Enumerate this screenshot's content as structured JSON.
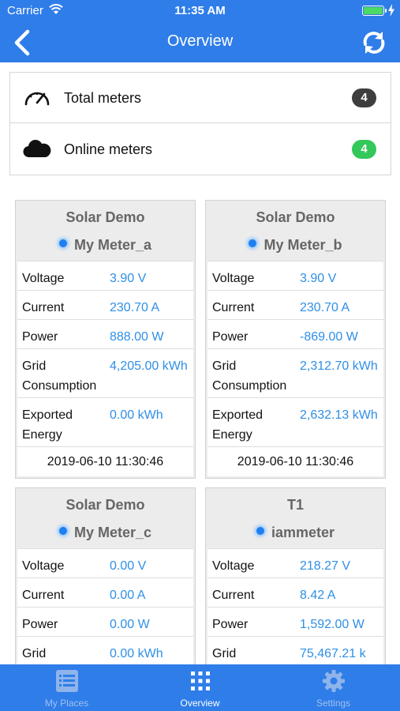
{
  "status_bar": {
    "carrier": "Carrier",
    "time": "11:35 AM"
  },
  "nav": {
    "title": "Overview",
    "back_icon": "chevron-left-icon",
    "refresh_icon": "refresh-icon"
  },
  "summary": {
    "total": {
      "label": "Total meters",
      "count": "4",
      "icon": "speedometer-icon"
    },
    "online": {
      "label": "Online meters",
      "count": "4",
      "icon": "cloud-icon"
    }
  },
  "colors": {
    "accent": "#2f7de9",
    "value_text": "#2f8fe6",
    "online_badge": "#34c759",
    "total_badge": "#3e3e3e"
  },
  "meters": [
    {
      "place": "Solar Demo",
      "name": "My Meter_a",
      "rows": [
        {
          "label": "Voltage",
          "value": "3.90 V"
        },
        {
          "label": "Current",
          "value": "230.70 A"
        },
        {
          "label": "Power",
          "value": "888.00 W"
        },
        {
          "label": "Grid Consumption",
          "value": "4,205.00 kWh"
        },
        {
          "label": "Exported Energy",
          "value": "0.00 kWh"
        }
      ],
      "timestamp": "2019-06-10 11:30:46"
    },
    {
      "place": "Solar Demo",
      "name": "My Meter_b",
      "rows": [
        {
          "label": "Voltage",
          "value": "3.90 V"
        },
        {
          "label": "Current",
          "value": "230.70 A"
        },
        {
          "label": "Power",
          "value": "-869.00 W"
        },
        {
          "label": "Grid Consumption",
          "value": "2,312.70 kWh"
        },
        {
          "label": "Exported Energy",
          "value": "2,632.13 kWh"
        }
      ],
      "timestamp": "2019-06-10 11:30:46"
    },
    {
      "place": "Solar Demo",
      "name": "My Meter_c",
      "rows": [
        {
          "label": "Voltage",
          "value": "0.00 V"
        },
        {
          "label": "Current",
          "value": "0.00 A"
        },
        {
          "label": "Power",
          "value": "0.00 W"
        },
        {
          "label": "Grid Consumption",
          "value": "0.00 kWh"
        }
      ]
    },
    {
      "place": "T1",
      "name": "iammeter",
      "rows": [
        {
          "label": "Voltage",
          "value": "218.27 V"
        },
        {
          "label": "Current",
          "value": "8.42 A"
        },
        {
          "label": "Power",
          "value": "1,592.00 W"
        },
        {
          "label": "Grid Consumption",
          "value": "75,467.21 k"
        }
      ]
    }
  ],
  "tabs": [
    {
      "label": "My Places",
      "icon": "list-icon",
      "active": false
    },
    {
      "label": "Overview",
      "icon": "grid-icon",
      "active": true
    },
    {
      "label": "Settings",
      "icon": "gear-icon",
      "active": false
    }
  ]
}
